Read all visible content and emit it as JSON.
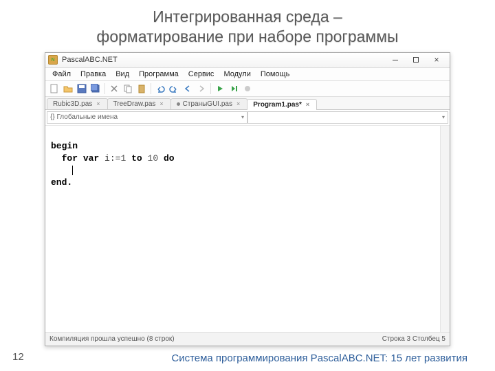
{
  "slide": {
    "title_line1": "Интегрированная среда –",
    "title_line2": "форматирование при наборе программы",
    "number": "12",
    "footer": "Система программирования PascalABC.NET: 15 лет развития"
  },
  "window": {
    "title": "PascalABC.NET",
    "menus": [
      "Файл",
      "Правка",
      "Вид",
      "Программа",
      "Сервис",
      "Модули",
      "Помощь"
    ],
    "tabs": [
      {
        "label": "Rubic3D.pas",
        "active": false,
        "dirty": false
      },
      {
        "label": "TreeDraw.pas",
        "active": false,
        "dirty": false
      },
      {
        "label": "СтраныGUI.pas",
        "active": false,
        "dirty": true
      },
      {
        "label": "Program1.pas*",
        "active": true,
        "dirty": false
      }
    ],
    "combo_label": "{} Глобальные имена",
    "status_left": "Компиляция прошла успешно (8 строк)",
    "status_right": "Строка  3  Столбец  5"
  },
  "code": {
    "begin": "begin",
    "for": "for",
    "var": "var",
    "ident": "i",
    "assign": ":=",
    "one": "1",
    "to": "to",
    "ten": "10",
    "do": "do",
    "end": "end."
  }
}
